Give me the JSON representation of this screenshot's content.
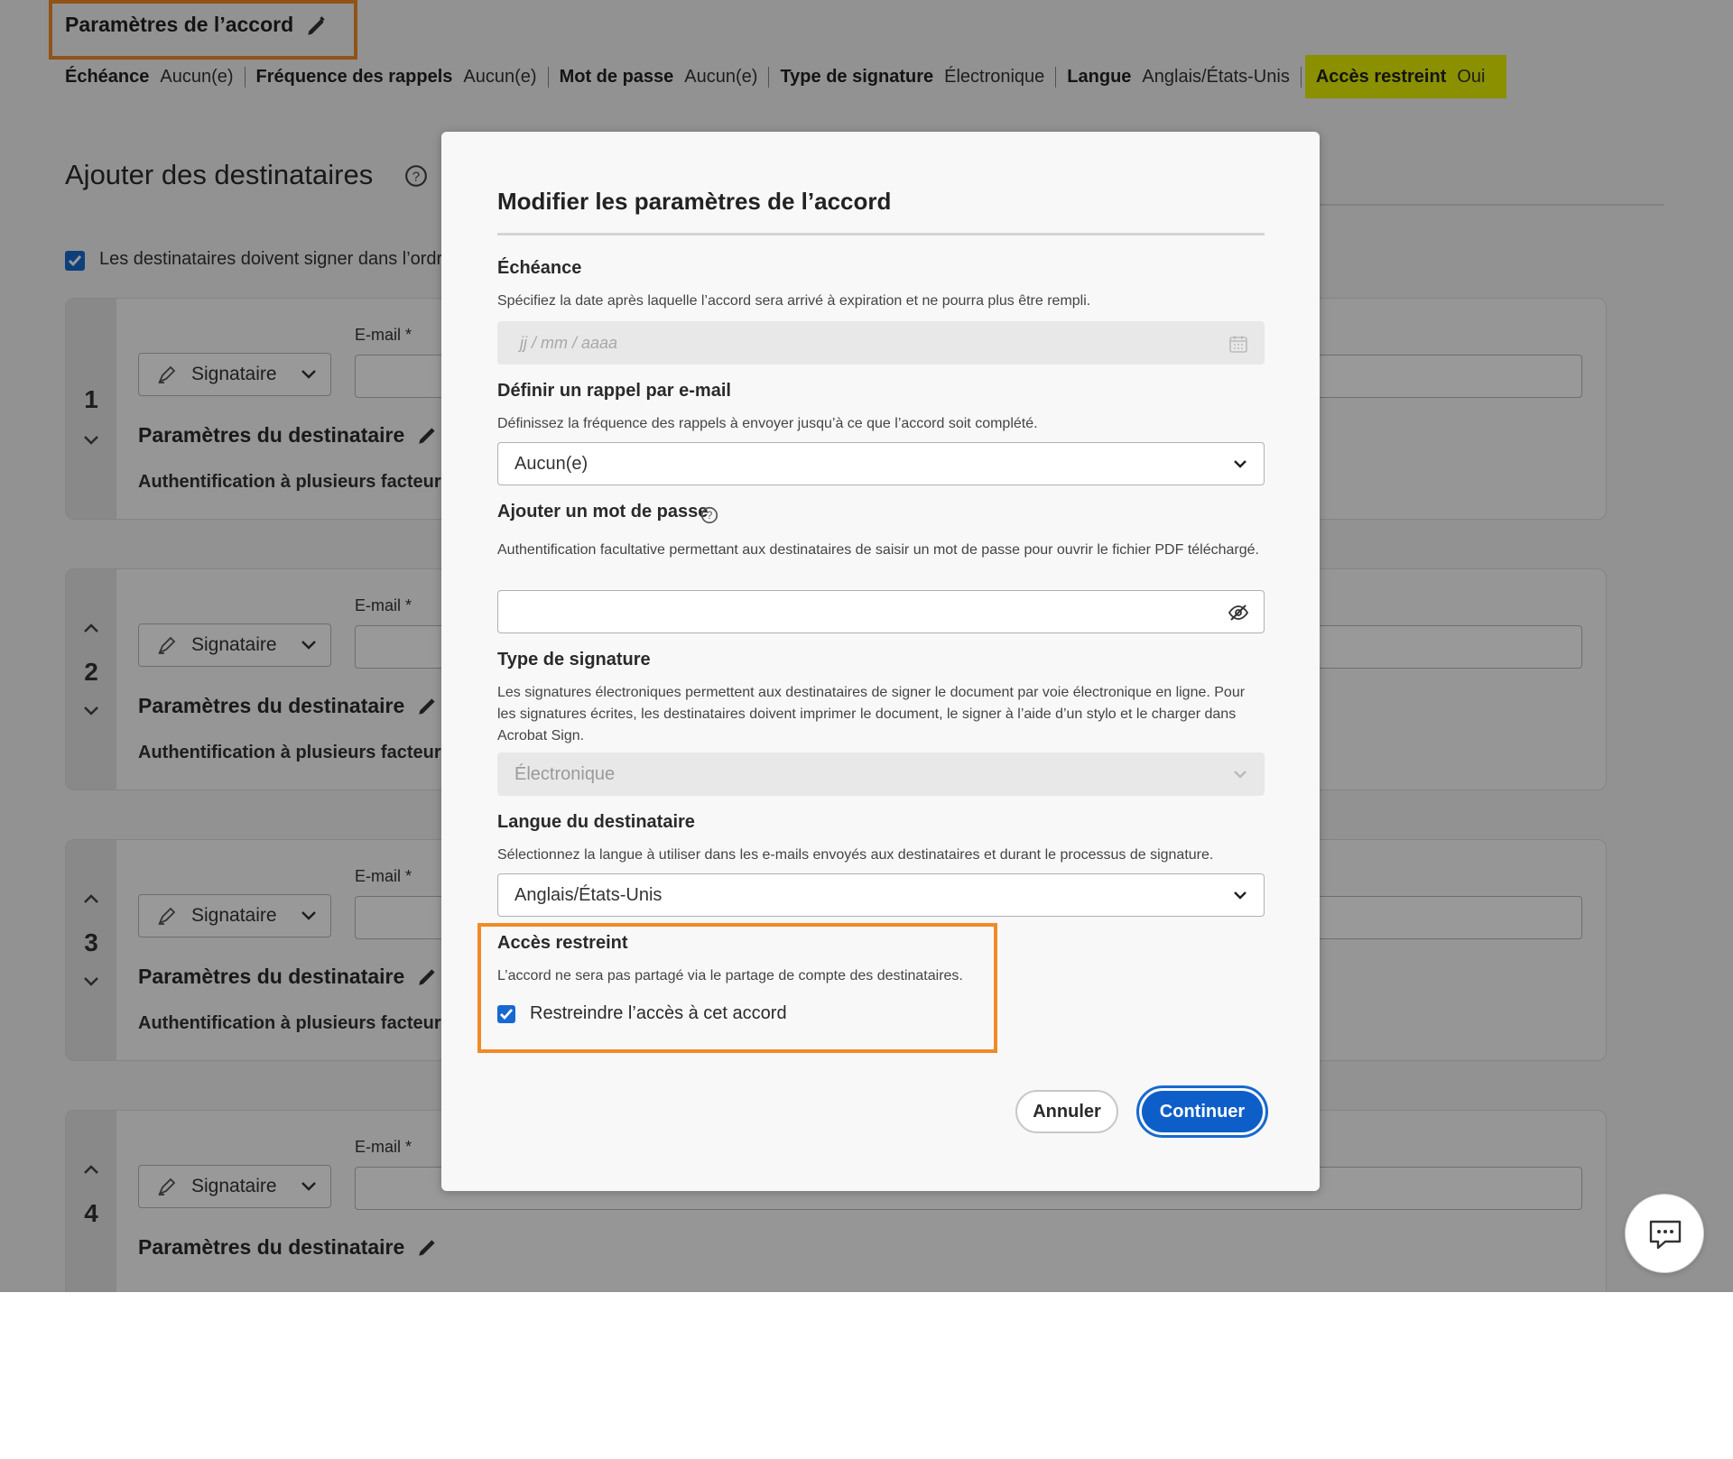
{
  "agreement_settings": {
    "title": "Paramètres de l’accord",
    "summary": [
      {
        "key": "Échéance",
        "value": "Aucun(e)"
      },
      {
        "key": "Fréquence des rappels",
        "value": "Aucun(e)"
      },
      {
        "key": "Mot de passe",
        "value": "Aucun(e)"
      },
      {
        "key": "Type de signature",
        "value": "Électronique"
      },
      {
        "key": "Langue",
        "value": "Anglais/États-Unis"
      },
      {
        "key": "Accès restreint",
        "value": "Oui"
      }
    ]
  },
  "recipients_section": {
    "title": "Ajouter des destinataires",
    "order_label": "Les destinataires doivent signer dans l’ordre.",
    "role_label": "Signataire",
    "email_label": "E-mail *",
    "params_label": "Paramètres du destinataire",
    "mfa_label": "Authentification à plusieurs facteurs",
    "numbers": [
      "1",
      "2",
      "3",
      "4"
    ]
  },
  "modal": {
    "title": "Modifier les paramètres de l’accord",
    "deadline": {
      "heading": "Échéance",
      "desc": "Spécifiez la date après laquelle l’accord sera arrivé à expiration et ne pourra plus être rempli.",
      "placeholder": "jj / mm / aaaa"
    },
    "reminder": {
      "heading": "Définir un rappel par e-mail",
      "desc": "Définissez la fréquence des rappels à envoyer jusqu’à ce que l’accord soit complété.",
      "value": "Aucun(e)"
    },
    "password": {
      "heading": "Ajouter un mot de passe",
      "desc": "Authentification facultative permettant aux destinataires de saisir un mot de passe pour ouvrir le fichier PDF téléchargé.",
      "value": ""
    },
    "signature_type": {
      "heading": "Type de signature",
      "desc": "Les signatures électroniques permettent aux destinataires de signer le document par voie électronique en ligne. Pour les signatures écrites, les destinataires doivent imprimer le document, le signer à l’aide d’un stylo et le charger dans Acrobat Sign.",
      "value": "Électronique"
    },
    "language": {
      "heading": "Langue du destinataire",
      "desc": "Sélectionnez la langue à utiliser dans les e-mails envoyés aux destinataires et durant le processus de signature.",
      "value": "Anglais/États-Unis"
    },
    "restricted": {
      "heading": "Accès restreint",
      "desc": "L’accord ne sera pas partagé via le partage de compte des destinataires.",
      "checkbox_label": "Restreindre l’accès à cet accord",
      "checked": true
    },
    "buttons": {
      "cancel": "Annuler",
      "continue": "Continuer"
    }
  },
  "colors": {
    "accent_blue": "#0d5ec9",
    "highlight_orange": "#f08a28",
    "highlight_yellow": "#e6f000"
  },
  "icons": [
    "pencil-icon",
    "help-icon",
    "calendar-icon",
    "chevron-down-icon",
    "eye-off-icon",
    "trash-icon",
    "chat-icon",
    "signature-pen-icon",
    "checkmark-icon"
  ]
}
